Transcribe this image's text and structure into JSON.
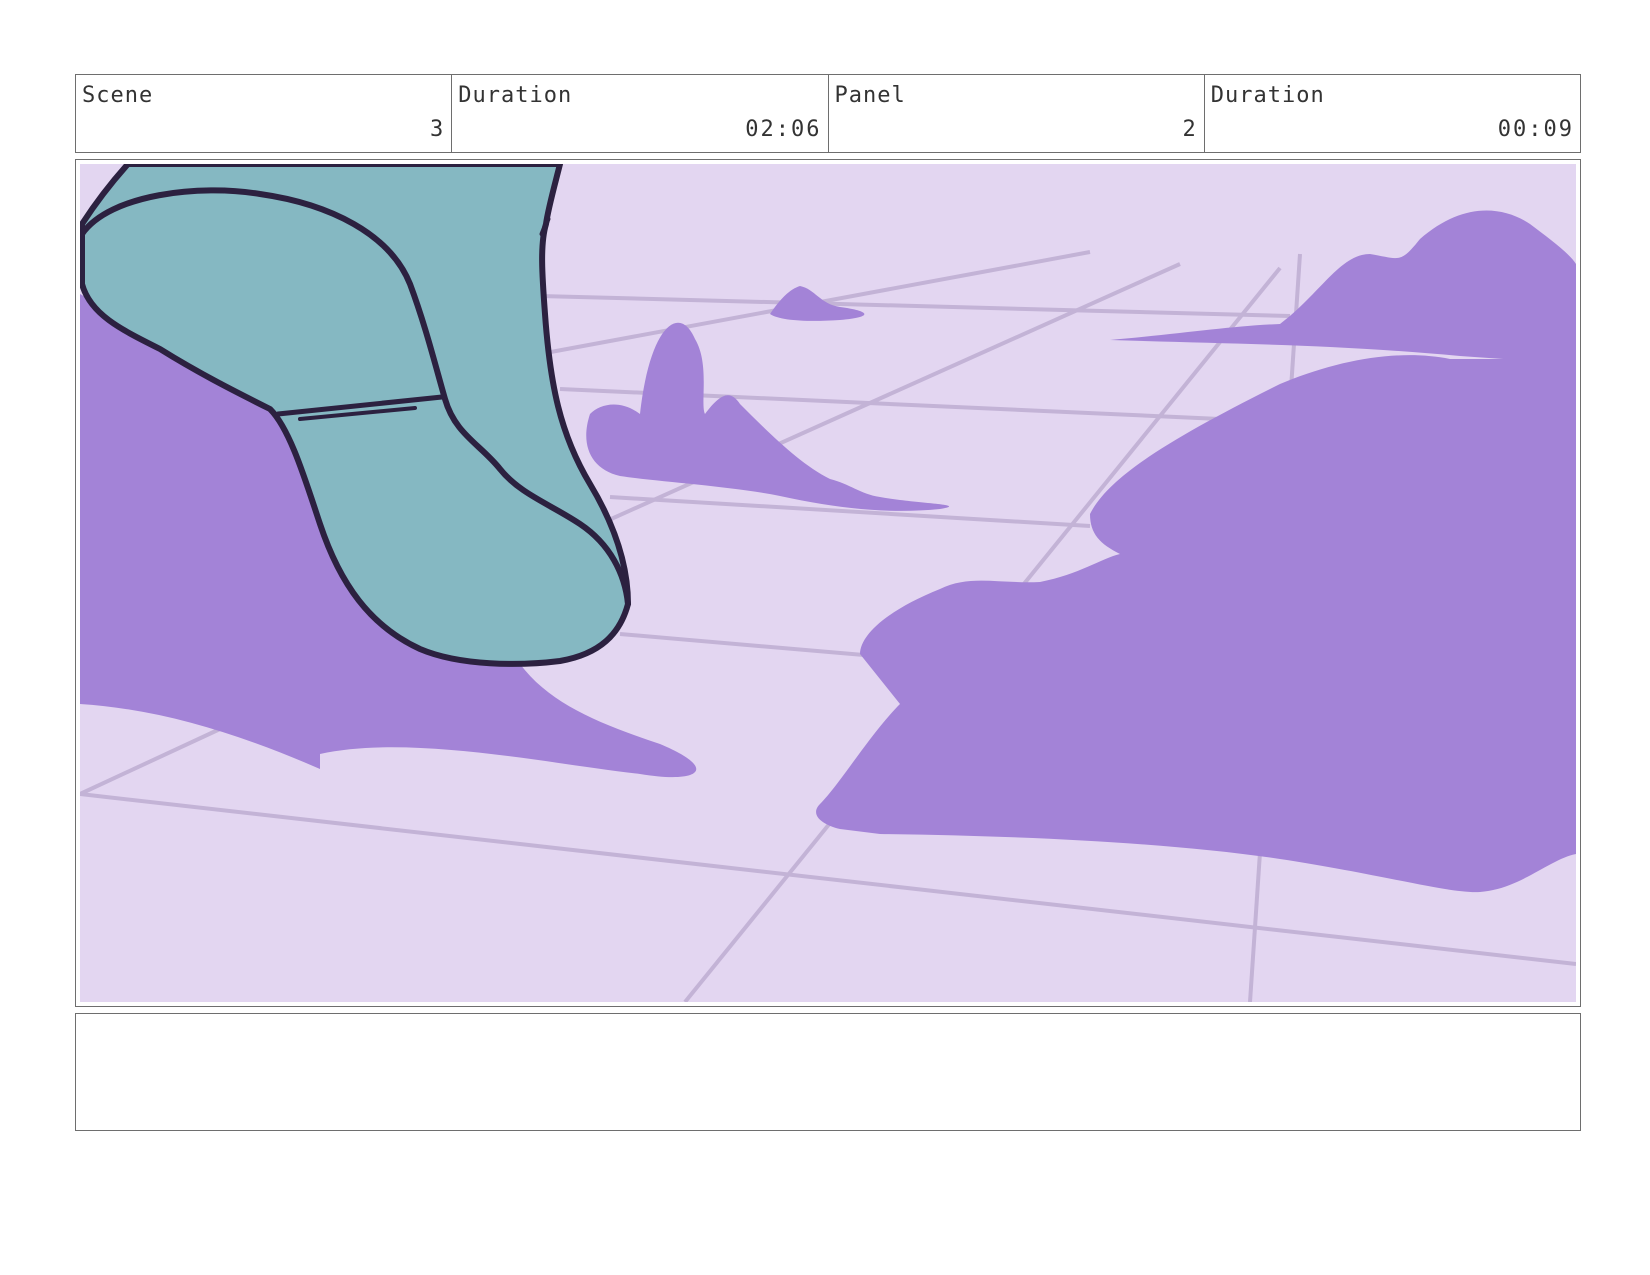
{
  "header": {
    "scene_label": "Scene",
    "scene_value": "3",
    "scene_duration_label": "Duration",
    "scene_duration_value": "02:06",
    "panel_label": "Panel",
    "panel_value": "2",
    "panel_duration_label": "Duration",
    "panel_duration_value": "00:09"
  },
  "panel_image": {
    "description_icon": "storyboard-frame-illustration",
    "colors": {
      "floor": "#e3d6f1",
      "grid_lines": "#c3b3d6",
      "shadow_purple": "#a383d7",
      "boot_teal": "#85b8c2",
      "outline": "#2c2140"
    }
  },
  "notes": {
    "text": ""
  }
}
